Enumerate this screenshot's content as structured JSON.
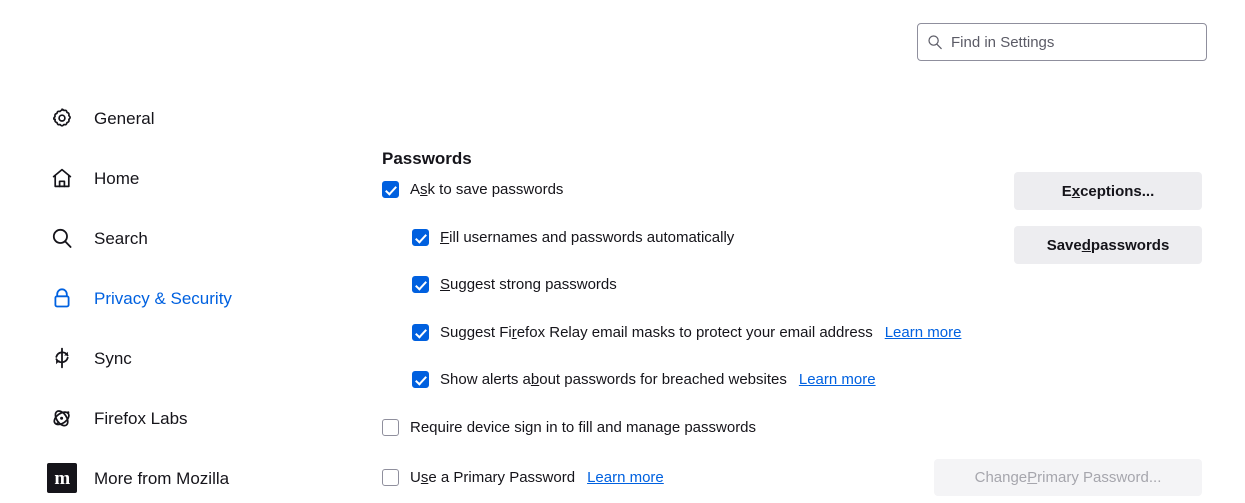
{
  "search": {
    "placeholder": "Find in Settings",
    "icon": "search-icon"
  },
  "sidebar": {
    "items": [
      {
        "label": "General",
        "icon": "gear-icon",
        "selected": false
      },
      {
        "label": "Home",
        "icon": "home-icon",
        "selected": false
      },
      {
        "label": "Search",
        "icon": "search-icon",
        "selected": false
      },
      {
        "label": "Privacy & Security",
        "icon": "lock-icon",
        "selected": true
      },
      {
        "label": "Sync",
        "icon": "sync-icon",
        "selected": false
      },
      {
        "label": "Firefox Labs",
        "icon": "atom-icon",
        "selected": false
      },
      {
        "label": "More from Mozilla",
        "icon": "mozilla-m-icon",
        "selected": false
      }
    ],
    "mozilla_mark": "m"
  },
  "main": {
    "section_title": "Passwords",
    "prefs": {
      "ask_to_save": {
        "pre": "A",
        "key": "s",
        "post": "k to save passwords",
        "checked": true
      },
      "fill_auto": {
        "pre": "",
        "key": "F",
        "post": "ill usernames and passwords automatically",
        "checked": true
      },
      "suggest_strong": {
        "pre": "",
        "key": "S",
        "post": "uggest strong passwords",
        "checked": true
      },
      "relay_masks": {
        "pre": "Suggest Fi",
        "key": "r",
        "post": "efox Relay email masks to protect your email address",
        "checked": true
      },
      "breach_alerts": {
        "pre": "Show alerts a",
        "key": "b",
        "post": "out passwords for breached websites",
        "checked": true
      },
      "require_device": {
        "pre": "Require device sign in to fill and manage passwords",
        "key": "",
        "post": "",
        "checked": false
      },
      "primary_password": {
        "pre": "U",
        "key": "s",
        "post": "e a Primary Password",
        "checked": false
      }
    },
    "learn_more": "Learn more"
  },
  "buttons": {
    "exceptions": {
      "pre": "E",
      "key": "x",
      "post": "ceptions...",
      "disabled": false
    },
    "saved_passwords": {
      "pre": "Save",
      "key": "d",
      "post": " passwords",
      "disabled": false
    },
    "change_primary": {
      "pre": "Change ",
      "key": "P",
      "post": "rimary Password...",
      "disabled": true
    }
  },
  "colors": {
    "accent": "#0061e0",
    "checkbox": "#0060df",
    "text": "#15141a",
    "muted": "#5b5b66",
    "button_bg": "#ededf0",
    "button_disabled_text": "#a6a6ad"
  }
}
